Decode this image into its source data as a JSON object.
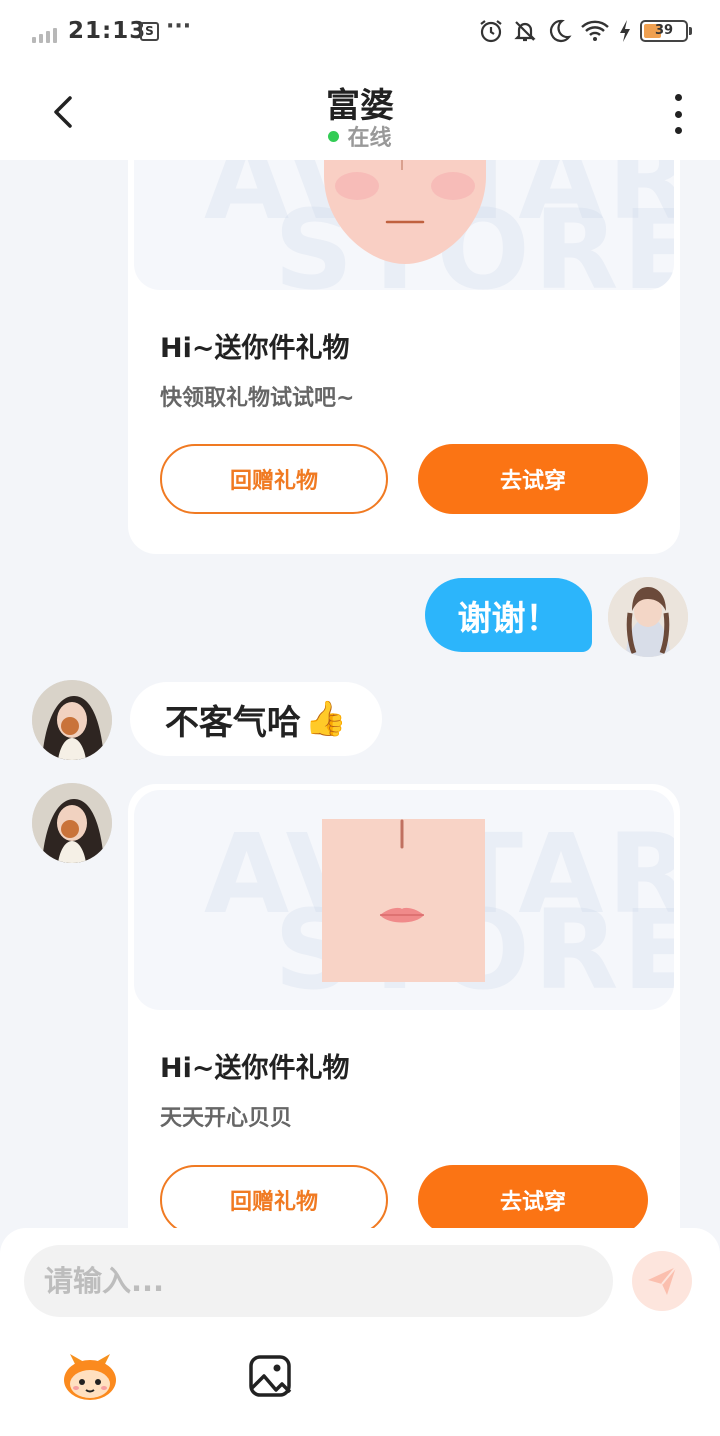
{
  "status_bar": {
    "time": "21:13",
    "s_badge": "S",
    "dots": "···",
    "battery": "39",
    "battery_color": "#f0a050"
  },
  "header": {
    "title": "富婆",
    "status": "在线",
    "status_color": "#33cc55"
  },
  "messages": {
    "gift1": {
      "title": "Hi~送你件礼物",
      "desc": "快领取礼物试试吧~",
      "btn_return": "回赠礼物",
      "btn_try": "去试穿"
    },
    "reply": "谢谢！",
    "received": {
      "text": "不客气哈",
      "emoji": "👍"
    },
    "gift2": {
      "title": "Hi~送你件礼物",
      "desc": "天天开心贝贝",
      "btn_return": "回赠礼物",
      "btn_try": "去试穿"
    },
    "watermark_top": "AVATAR",
    "watermark_bottom": "STORE"
  },
  "input": {
    "placeholder": "请输入..."
  },
  "colors": {
    "accent": "#fb7414",
    "bubble_blue": "#2cb5fb",
    "background": "#f3f5f9"
  },
  "icons": [
    "back-icon",
    "more-icon",
    "alarm-icon",
    "mute-icon",
    "moon-icon",
    "wifi-icon",
    "charging-icon",
    "send-icon",
    "emoji-mascot-icon",
    "image-icon"
  ]
}
